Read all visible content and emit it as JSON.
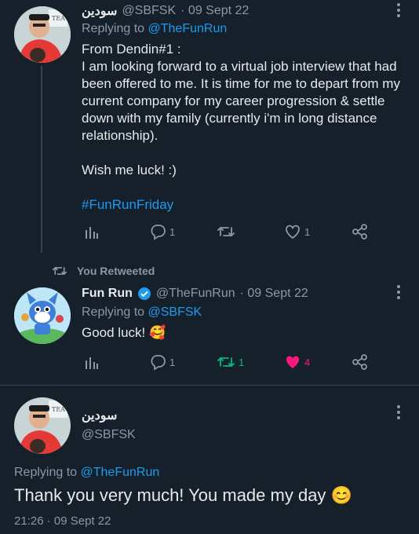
{
  "tweet1": {
    "display_name": "سودين",
    "handle": "@SBFSK",
    "date": "· 09 Sept 22",
    "replying_prefix": "Replying to",
    "replying_to": "@TheFunRun",
    "body_line1": "From Dendin#1 :",
    "body_line2": "I am looking forward to a virtual job interview that had",
    "body_line3": "been offered to me. It is time for me to depart from my",
    "body_line4": "current company for my career progression & settle",
    "body_line5": "down with my family (currently i'm in long distance",
    "body_line6": "relationship).",
    "body_line7": "Wish me luck! :)",
    "hashtag": "#FunRunFriday",
    "reply_count": "1",
    "retweet_count": "",
    "like_count": "1"
  },
  "retweet_banner": {
    "label": "You Retweeted"
  },
  "tweet2": {
    "display_name": "Fun Run",
    "handle": "@TheFunRun",
    "date": "· 09 Sept 22",
    "replying_prefix": "Replying to",
    "replying_to": "@SBFSK",
    "body": "Good luck! 🥰",
    "reply_count": "1",
    "retweet_count": "1",
    "like_count": "4"
  },
  "main_tweet": {
    "display_name": "سودين",
    "handle": "@SBFSK",
    "replying_prefix": "Replying to",
    "replying_to": "@TheFunRun",
    "body": "Thank you very much! You made my day 😊",
    "timestamp": "21:26 · 09 Sept 22"
  },
  "colors": {
    "background": "#15202b",
    "link": "#1d9bf0",
    "retweet_active": "#00ba7c",
    "like_active": "#f91880",
    "muted": "#8b98a5"
  }
}
